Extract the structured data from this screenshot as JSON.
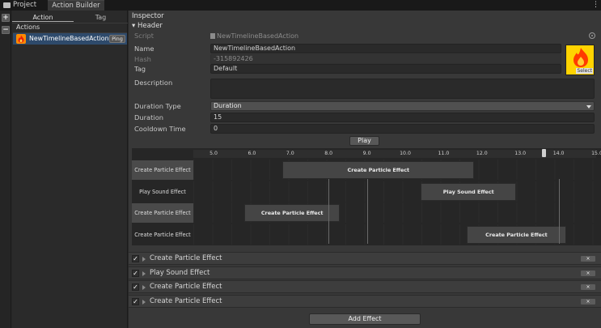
{
  "window_tabs": [
    {
      "label": "Project"
    },
    {
      "label": "Action Builder"
    }
  ],
  "left": {
    "tabs": [
      "Action",
      "Tag"
    ],
    "header": "Actions",
    "item": {
      "label": "NewTimelineBasedAction",
      "ping": "Ping"
    }
  },
  "inspector": {
    "title": "Inspector",
    "header_fold": "Header",
    "script": {
      "label": "Script",
      "value": "NewTimelineBasedAction"
    },
    "name": {
      "label": "Name",
      "value": "NewTimelineBasedAction"
    },
    "hash": {
      "label": "Hash",
      "value": "-315892426"
    },
    "tag": {
      "label": "Tag",
      "value": "Default"
    },
    "description": {
      "label": "Description",
      "value": ""
    },
    "duration_type": {
      "label": "Duration Type",
      "value": "Duration"
    },
    "duration": {
      "label": "Duration",
      "value": "15"
    },
    "cooldown": {
      "label": "Cooldown Time",
      "value": "0"
    },
    "icon_select": "Select",
    "play": "Play",
    "timeline": {
      "ticks": [
        "5.0",
        "6.0",
        "7.0",
        "8.0",
        "9.0",
        "10.0",
        "11.0",
        "12.0",
        "13.0",
        "14.0",
        "15.0"
      ],
      "playhead": 13.6,
      "tracks": [
        {
          "label": "Create Particle Effect",
          "clip": "Create Particle Effect",
          "start": 6.8,
          "end": 11.8,
          "highlight": true
        },
        {
          "label": "Play Sound Effect",
          "clip": "Play Sound Effect",
          "start": 10.4,
          "end": 12.9,
          "highlight": false
        },
        {
          "label": "Create Particle Effect",
          "clip": "Create Particle Effect",
          "start": 5.8,
          "end": 8.3,
          "highlight": true
        },
        {
          "label": "Create Particle Effect",
          "clip": "Create Particle Effect",
          "start": 11.6,
          "end": 14.2,
          "highlight": false
        }
      ],
      "markers": [
        8.0,
        9.0,
        14.0
      ]
    },
    "effects": [
      {
        "label": "Create Particle Effect",
        "remove": "×"
      },
      {
        "label": "Play Sound Effect",
        "remove": "×"
      },
      {
        "label": "Create Particle Effect",
        "remove": "×"
      },
      {
        "label": "Create Particle Effect",
        "remove": "×"
      }
    ],
    "add_effect": "Add Effect"
  },
  "colors": {
    "accent_select": "#2e4a6b",
    "icon_bg": "#ffd300",
    "icon_flame": "#ff3b00"
  }
}
